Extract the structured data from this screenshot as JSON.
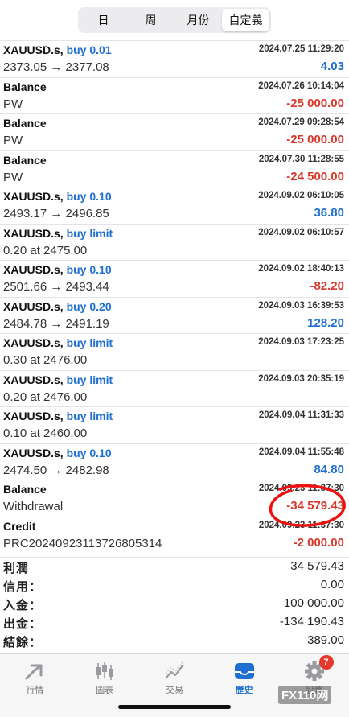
{
  "tabs": [
    {
      "label": "日",
      "active": false
    },
    {
      "label": "周",
      "active": false
    },
    {
      "label": "月份",
      "active": false
    },
    {
      "label": "自定義",
      "active": true
    }
  ],
  "history": [
    {
      "symbol": "XAUUSD.s,",
      "action": "buy 0.01",
      "detail": "2373.05 → 2377.08",
      "datetime": "2024.07.25 11:29:20",
      "amount": "4.03",
      "sign": "pos"
    },
    {
      "symbol": "Balance",
      "action": "",
      "detail": "PW",
      "datetime": "2024.07.26 10:14:04",
      "amount": "-25 000.00",
      "sign": "neg"
    },
    {
      "symbol": "Balance",
      "action": "",
      "detail": "PW",
      "datetime": "2024.07.29 09:28:54",
      "amount": "-25 000.00",
      "sign": "neg"
    },
    {
      "symbol": "Balance",
      "action": "",
      "detail": "PW",
      "datetime": "2024.07.30 11:28:55",
      "amount": "-24 500.00",
      "sign": "neg"
    },
    {
      "symbol": "XAUUSD.s,",
      "action": "buy 0.10",
      "detail": "2493.17 → 2496.85",
      "datetime": "2024.09.02 06:10:05",
      "amount": "36.80",
      "sign": "pos"
    },
    {
      "symbol": "XAUUSD.s,",
      "action": "buy limit",
      "detail": "0.20 at 2475.00",
      "datetime": "2024.09.02 06:10:57",
      "amount": "",
      "sign": ""
    },
    {
      "symbol": "XAUUSD.s,",
      "action": "buy 0.10",
      "detail": "2501.66 → 2493.44",
      "datetime": "2024.09.02 18:40:13",
      "amount": "-82.20",
      "sign": "neg"
    },
    {
      "symbol": "XAUUSD.s,",
      "action": "buy 0.20",
      "detail": "2484.78 → 2491.19",
      "datetime": "2024.09.03 16:39:53",
      "amount": "128.20",
      "sign": "pos"
    },
    {
      "symbol": "XAUUSD.s,",
      "action": "buy limit",
      "detail": "0.30 at 2476.00",
      "datetime": "2024.09.03 17:23:25",
      "amount": "",
      "sign": ""
    },
    {
      "symbol": "XAUUSD.s,",
      "action": "buy limit",
      "detail": "0.20 at 2476.00",
      "datetime": "2024.09.03 20:35:19",
      "amount": "",
      "sign": ""
    },
    {
      "symbol": "XAUUSD.s,",
      "action": "buy limit",
      "detail": "0.10 at 2460.00",
      "datetime": "2024.09.04 11:31:33",
      "amount": "",
      "sign": ""
    },
    {
      "symbol": "XAUUSD.s,",
      "action": "buy 0.10",
      "detail": "2474.50 → 2482.98",
      "datetime": "2024.09.04 11:55:48",
      "amount": "84.80",
      "sign": "pos"
    },
    {
      "symbol": "Balance",
      "action": "",
      "detail": "Withdrawal",
      "datetime": "2024.09.23 11:37:30",
      "amount": "-34 579.43",
      "sign": "neg"
    },
    {
      "symbol": "Credit",
      "action": "",
      "detail": "PRC20240923113726805314",
      "datetime": "2024.09.23 11:37:30",
      "amount": "-2 000.00",
      "sign": "neg"
    }
  ],
  "summary": {
    "profit_label": "利潤",
    "profit_value": "34 579.43",
    "credit_label": "信用：",
    "credit_value": "0.00",
    "deposit_label": "入金：",
    "deposit_value": "100 000.00",
    "withdrawal_label": "出金：",
    "withdrawal_value": "-134 190.43",
    "balance_label": "結餘：",
    "balance_value": "389.00"
  },
  "nav": {
    "quotes": "行情",
    "charts": "圖表",
    "trade": "交易",
    "history": "歷史",
    "settings": "設置",
    "settings_badge": "7"
  },
  "watermark": "FX110网",
  "colors": {
    "positive": "#1f6fd1",
    "negative": "#d8382b",
    "annotation_red": "#ee1111",
    "active_nav": "#1f6fd1"
  }
}
